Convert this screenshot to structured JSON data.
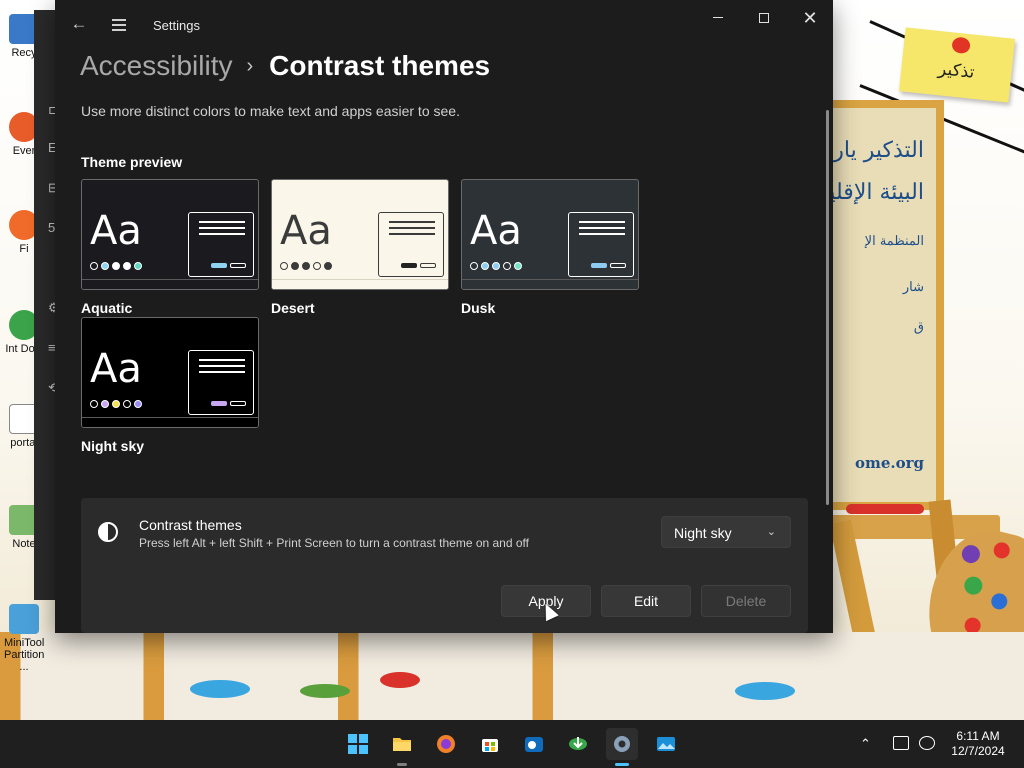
{
  "window": {
    "title": "Settings",
    "controls": {
      "minimize": "",
      "maximize": "",
      "close": "✕"
    }
  },
  "breadcrumb": {
    "parent": "Accessibility",
    "separator": "›",
    "current": "Contrast themes"
  },
  "description": "Use more distinct colors to make text and apps easier to see.",
  "theme_preview": {
    "title": "Theme preview",
    "themes": [
      {
        "name": "Aquatic",
        "sample": "Aa",
        "bg": "#1b1b1f",
        "fg": "#ffffff",
        "accent": "#8ed3f0",
        "dots": [
          "#1b1b1f",
          "#8ed3f0",
          "#ffffff",
          "#ffffff",
          "#5fd7c2"
        ]
      },
      {
        "name": "Desert",
        "sample": "Aa",
        "bg": "#fbf6ea",
        "fg": "#3b3b3b",
        "accent": "#222222",
        "dots": [
          "#fbf6ea",
          "#3b3b3b",
          "#3b3b3b",
          "#fbf6ea",
          "#3b3b3b"
        ]
      },
      {
        "name": "Dusk",
        "sample": "Aa",
        "bg": "#2d3236",
        "fg": "#ffffff",
        "accent": "#8ecbf1",
        "dots": [
          "#2d3236",
          "#8ecbf1",
          "#8ecbf1",
          "#2d3236",
          "#75e3c8"
        ]
      },
      {
        "name": "Night sky",
        "sample": "Aa",
        "bg": "#000000",
        "fg": "#ffffff",
        "accent": "#c8a6f2",
        "dots": [
          "#000000",
          "#c8a6f2",
          "#f4e34a",
          "#000000",
          "#9a8cf6"
        ]
      }
    ]
  },
  "setting": {
    "title": "Contrast themes",
    "description": "Press left Alt + left Shift + Print Screen to turn a contrast theme on and off",
    "selected_theme": "Night sky",
    "icon": "contrast-icon"
  },
  "buttons": {
    "apply": "Apply",
    "edit": "Edit",
    "delete": "Delete"
  },
  "taskbar": {
    "apps": [
      "start",
      "file-explorer",
      "firefox",
      "microsoft-store",
      "outlook",
      "internet-download-manager",
      "settings",
      "photos"
    ],
    "time": "6:11 AM",
    "date": "12/7/2024"
  },
  "desktop": {
    "icons": [
      {
        "label": "Recy"
      },
      {
        "label": "Ever"
      },
      {
        "label": "Fi"
      },
      {
        "label": "Int Dow"
      },
      {
        "label": "portal"
      },
      {
        "label": "Note"
      },
      {
        "label": "MiniTool Partition ..."
      }
    ],
    "sticky_note": "تذكير",
    "board_lines": [
      "التذكير يارب",
      "البيئة الإقليم",
      "المنظمة الإ",
      "شار",
      "ق",
      "ome.org"
    ]
  },
  "colors": {
    "window_bg": "#1c1c1c",
    "panel_bg": "#2b2b2b",
    "accent": "#4cc2ff"
  }
}
